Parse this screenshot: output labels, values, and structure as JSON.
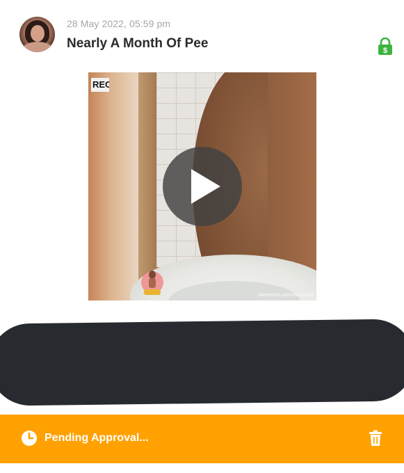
{
  "post": {
    "date": "28 May 2022, 05:59 pm",
    "title": "Nearly A Month Of Pee",
    "locked_icon": "lock-dollar-icon",
    "lock_color": "#3db43d"
  },
  "video": {
    "overlay_text": "REC",
    "watermark": "fancentro.com/narijems",
    "play_icon": "play-icon"
  },
  "status": {
    "text": "Pending Approval...",
    "clock_icon": "clock-icon",
    "delete_icon": "trash-icon",
    "background": "#ffa100"
  }
}
